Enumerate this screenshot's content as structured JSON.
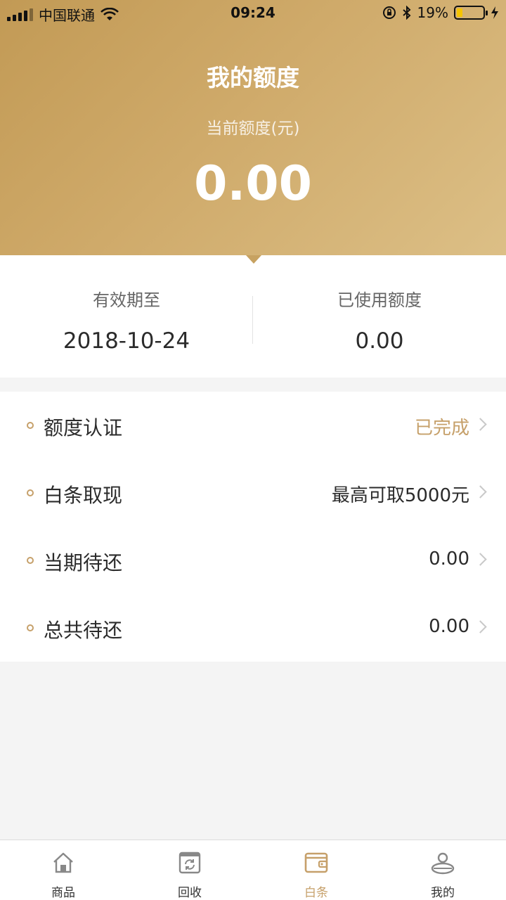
{
  "status_bar": {
    "carrier": "中国联通",
    "time": "09:24",
    "battery": "19%"
  },
  "header": {
    "title": "我的额度",
    "quota_label": "当前额度(元)",
    "quota_value": "0.00"
  },
  "info": {
    "expiry_label": "有效期至",
    "expiry_value": "2018-10-24",
    "used_label": "已使用额度",
    "used_value": "0.00"
  },
  "menu": [
    {
      "label": "额度认证",
      "value": "已完成",
      "accent": true
    },
    {
      "label": "白条取现",
      "value": "最高可取5000元",
      "accent": false
    },
    {
      "label": "当期待还",
      "value": "0.00",
      "accent": false
    },
    {
      "label": "总共待还",
      "value": "0.00",
      "accent": false
    }
  ],
  "tabbar": {
    "items": [
      {
        "label": "商品",
        "icon": "home-icon"
      },
      {
        "label": "回收",
        "icon": "recycle-icon"
      },
      {
        "label": "白条",
        "icon": "wallet-icon",
        "active": true
      },
      {
        "label": "我的",
        "icon": "profile-icon"
      }
    ]
  },
  "colors": {
    "accent": "#c6a06a",
    "header_gradient_start": "#c29a55",
    "header_gradient_end": "#dcbf86"
  }
}
